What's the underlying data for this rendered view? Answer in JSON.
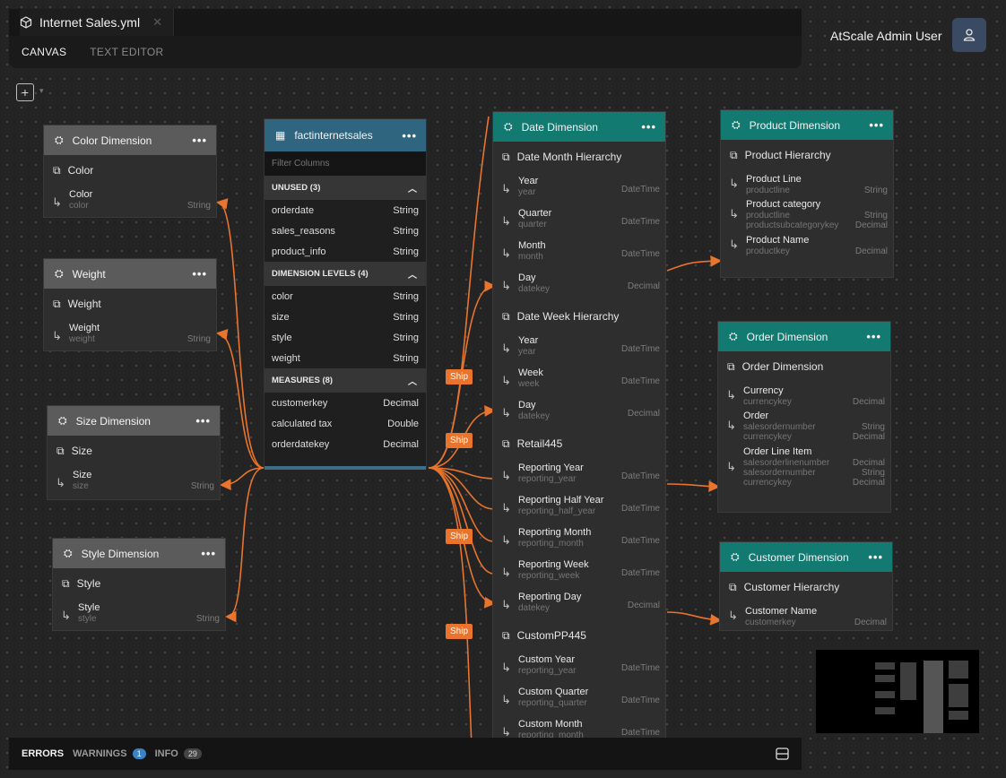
{
  "header": {
    "file_tab": "Internet Sales.yml",
    "close_glyph": "✕",
    "modes": [
      "CANVAS",
      "TEXT EDITOR"
    ],
    "user_name": "AtScale Admin User"
  },
  "toolbar": {
    "add_glyph": "+",
    "caret_glyph": "▾"
  },
  "dimensions_left": [
    {
      "title": "Color Dimension",
      "hierarchy": "Color",
      "level": {
        "name": "Color",
        "column": "color",
        "type": "String"
      }
    },
    {
      "title": "Weight",
      "hierarchy": "Weight",
      "level": {
        "name": "Weight",
        "column": "weight",
        "type": "String"
      }
    },
    {
      "title": "Size Dimension",
      "hierarchy": "Size",
      "level": {
        "name": "Size",
        "column": "size",
        "type": "String"
      }
    },
    {
      "title": "Style Dimension",
      "hierarchy": "Style",
      "level": {
        "name": "Style",
        "column": "style",
        "type": "String"
      }
    }
  ],
  "fact_table": {
    "title": "factinternetsales",
    "filter_placeholder": "Filter Columns",
    "sections": [
      {
        "label": "UNUSED (3)",
        "rows": [
          {
            "name": "orderdate",
            "type": "String"
          },
          {
            "name": "sales_reasons",
            "type": "String"
          },
          {
            "name": "product_info",
            "type": "String"
          }
        ]
      },
      {
        "label": "DIMENSION LEVELS (4)",
        "rows": [
          {
            "name": "color",
            "type": "String"
          },
          {
            "name": "size",
            "type": "String"
          },
          {
            "name": "style",
            "type": "String"
          },
          {
            "name": "weight",
            "type": "String"
          }
        ]
      },
      {
        "label": "MEASURES (8)",
        "rows": [
          {
            "name": "customerkey",
            "type": "Decimal"
          },
          {
            "name": "calculated tax",
            "type": "Double"
          },
          {
            "name": "orderdatekey",
            "type": "Decimal"
          }
        ]
      }
    ]
  },
  "date_dimension": {
    "title": "Date Dimension",
    "hierarchies": [
      {
        "name": "Date Month Hierarchy",
        "levels": [
          {
            "name": "Year",
            "column": "year",
            "type": "DateTime"
          },
          {
            "name": "Quarter",
            "column": "quarter",
            "type": "DateTime"
          },
          {
            "name": "Month",
            "column": "month",
            "type": "DateTime"
          },
          {
            "name": "Day",
            "column": "datekey",
            "type": "Decimal"
          }
        ]
      },
      {
        "name": "Date Week Hierarchy",
        "levels": [
          {
            "name": "Year",
            "column": "year",
            "type": "DateTime"
          },
          {
            "name": "Week",
            "column": "week",
            "type": "DateTime"
          },
          {
            "name": "Day",
            "column": "datekey",
            "type": "Decimal"
          }
        ]
      },
      {
        "name": "Retail445",
        "levels": [
          {
            "name": "Reporting Year",
            "column": "reporting_year",
            "type": "DateTime"
          },
          {
            "name": "Reporting Half Year",
            "column": "reporting_half_year",
            "type": "DateTime"
          },
          {
            "name": "Reporting Month",
            "column": "reporting_month",
            "type": "DateTime"
          },
          {
            "name": "Reporting Week",
            "column": "reporting_week",
            "type": "DateTime"
          },
          {
            "name": "Reporting Day",
            "column": "datekey",
            "type": "Decimal"
          }
        ]
      },
      {
        "name": "CustomPP445",
        "levels": [
          {
            "name": "Custom Year",
            "column": "reporting_year",
            "type": "DateTime"
          },
          {
            "name": "Custom Quarter",
            "column": "reporting_quarter",
            "type": "DateTime"
          },
          {
            "name": "Custom Month",
            "column": "reporting_month",
            "type": "DateTime"
          }
        ]
      }
    ]
  },
  "product_dimension": {
    "title": "Product Dimension",
    "hierarchy": "Product Hierarchy",
    "levels": [
      {
        "name": "Product Line",
        "columns": [
          "productline"
        ],
        "types": [
          "String"
        ]
      },
      {
        "name": "Product category",
        "columns": [
          "productline",
          "productsubcategorykey"
        ],
        "types": [
          "String",
          "Decimal"
        ]
      },
      {
        "name": "Product Name",
        "columns": [
          "productkey"
        ],
        "types": [
          "Decimal"
        ]
      }
    ]
  },
  "order_dimension": {
    "title": "Order Dimension",
    "hierarchy": "Order Dimension",
    "levels": [
      {
        "name": "Currency",
        "columns": [
          "currencykey"
        ],
        "types": [
          "Decimal"
        ]
      },
      {
        "name": "Order",
        "columns": [
          "salesordernumber",
          "currencykey"
        ],
        "types": [
          "String",
          "Decimal"
        ]
      },
      {
        "name": "Order Line Item",
        "columns": [
          "salesorderlinenumber",
          "salesordernumber",
          "currencykey"
        ],
        "types": [
          "Decimal",
          "String",
          "Decimal"
        ]
      }
    ]
  },
  "customer_dimension": {
    "title": "Customer Dimension",
    "hierarchy": "Customer Hierarchy",
    "levels": [
      {
        "name": "Customer Name",
        "columns": [
          "customerkey"
        ],
        "types": [
          "Decimal"
        ]
      }
    ]
  },
  "ship_labels": [
    "Ship",
    "Ship",
    "Ship",
    "Ship"
  ],
  "bottom_bar": {
    "errors": "ERRORS",
    "warnings": "WARNINGS",
    "warnings_count": "1",
    "info": "INFO",
    "info_count": "29"
  },
  "colors": {
    "wire": "#e8742d",
    "teal_header": "#127a70",
    "gray_header": "#5b5b5b",
    "fact_header": "#2f657f"
  },
  "icons": [
    "cube-icon",
    "close-icon",
    "user-icon",
    "plus-square-icon",
    "dimension-icon",
    "table-icon",
    "hierarchy-icon",
    "level-arrow-icon",
    "more-icon",
    "chevron-up-icon",
    "panel-icon"
  ]
}
